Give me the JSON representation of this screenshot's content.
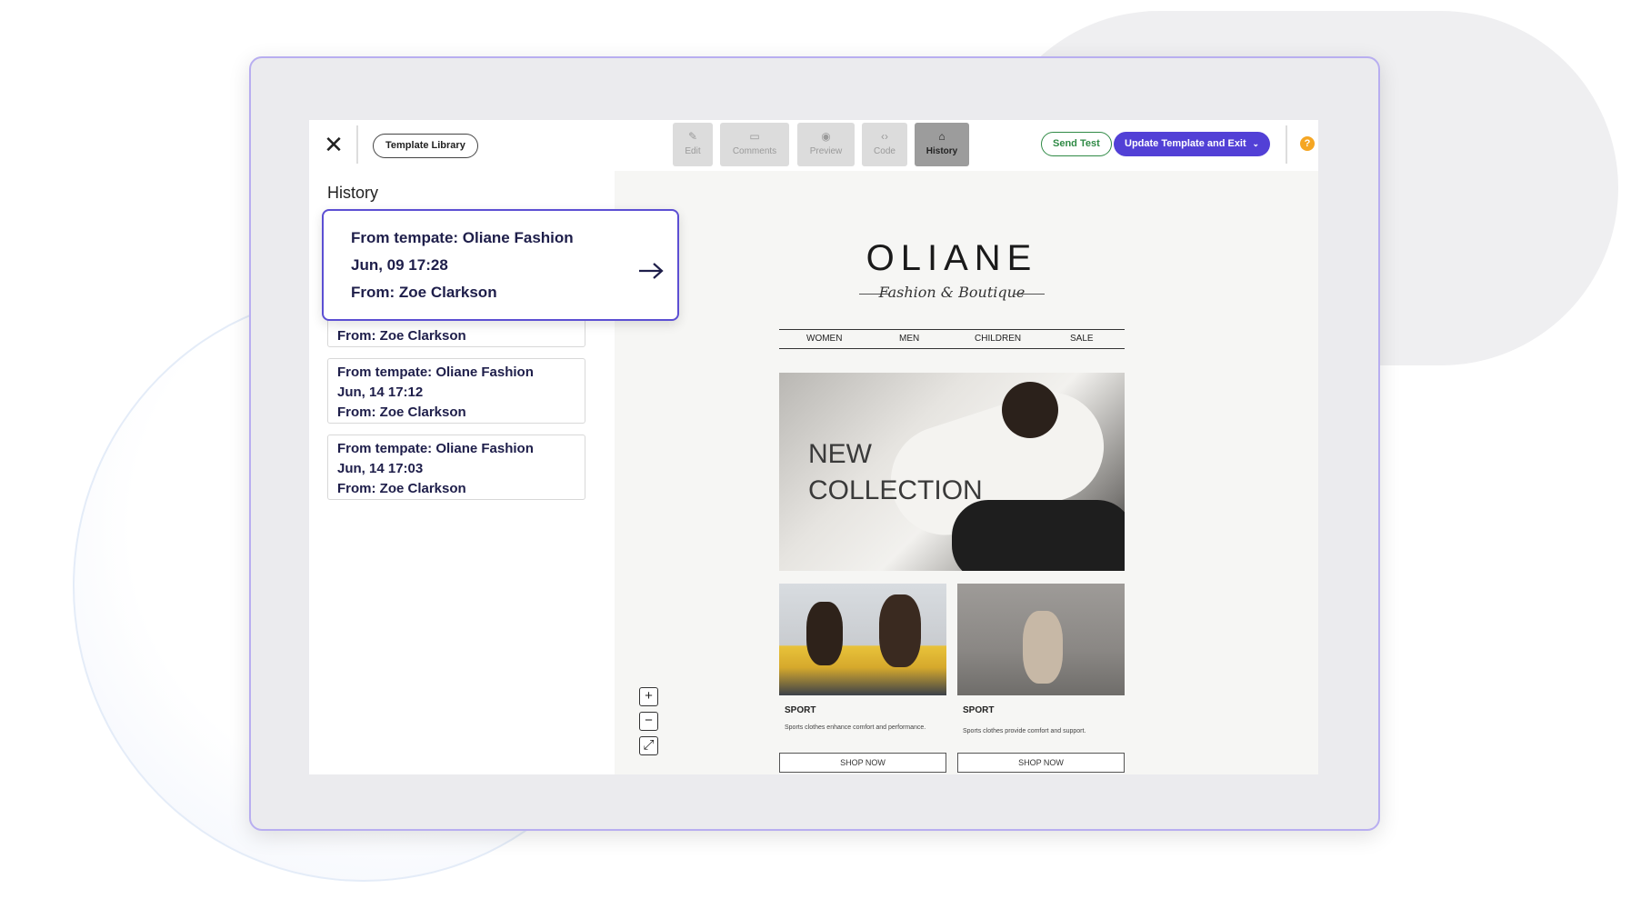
{
  "toolbar": {
    "close_label": "✕",
    "template_library_label": "Template Library",
    "tabs": [
      {
        "label": "Edit",
        "icon": "pencil-icon",
        "glyph": "✎"
      },
      {
        "label": "Comments",
        "icon": "comment-icon",
        "glyph": "▭"
      },
      {
        "label": "Preview",
        "icon": "eye-icon",
        "glyph": "◉"
      },
      {
        "label": "Code",
        "icon": "code-icon",
        "glyph": "‹›"
      },
      {
        "label": "History",
        "icon": "history-icon",
        "glyph": "⌂"
      }
    ],
    "active_tab": "History",
    "send_test_label": "Send Test",
    "update_label": "Update Template and Exit",
    "help_glyph": "?"
  },
  "history": {
    "title": "History",
    "focused": {
      "line1": "From tempate: Oliane Fashion",
      "line2": "Jun, 09 17:28",
      "line3": "From:  Zoe Clarkson"
    },
    "partial_card": {
      "from": "From: Zoe Clarkson"
    },
    "items": [
      {
        "template": "From tempate: Oliane Fashion",
        "date": "Jun, 14 17:12",
        "from": "From: Zoe Clarkson"
      },
      {
        "template": "From tempate: Oliane Fashion",
        "date": "Jun, 14 17:03",
        "from": "From: Zoe Clarkson"
      }
    ]
  },
  "email": {
    "logo": "OLIANE",
    "tagline": "Fashion & Boutique",
    "nav": [
      "WOMEN",
      "MEN",
      "CHILDREN",
      "SALE"
    ],
    "hero_line1": "NEW",
    "hero_line2": "COLLECTION",
    "products": [
      {
        "title": "SPORT",
        "desc": "Sports clothes enhance comfort and performance.",
        "button": "SHOP NOW"
      },
      {
        "title": "SPORT",
        "desc": "Sports clothes provide comfort and support.",
        "button": "SHOP NOW"
      }
    ]
  },
  "zoom": {
    "plus": "+",
    "minus": "−",
    "fit": "⤢"
  },
  "colors": {
    "accent": "#5240d6",
    "send_test": "#2f8a45",
    "focus_border": "#5c4fd3",
    "help": "#f5a623"
  }
}
